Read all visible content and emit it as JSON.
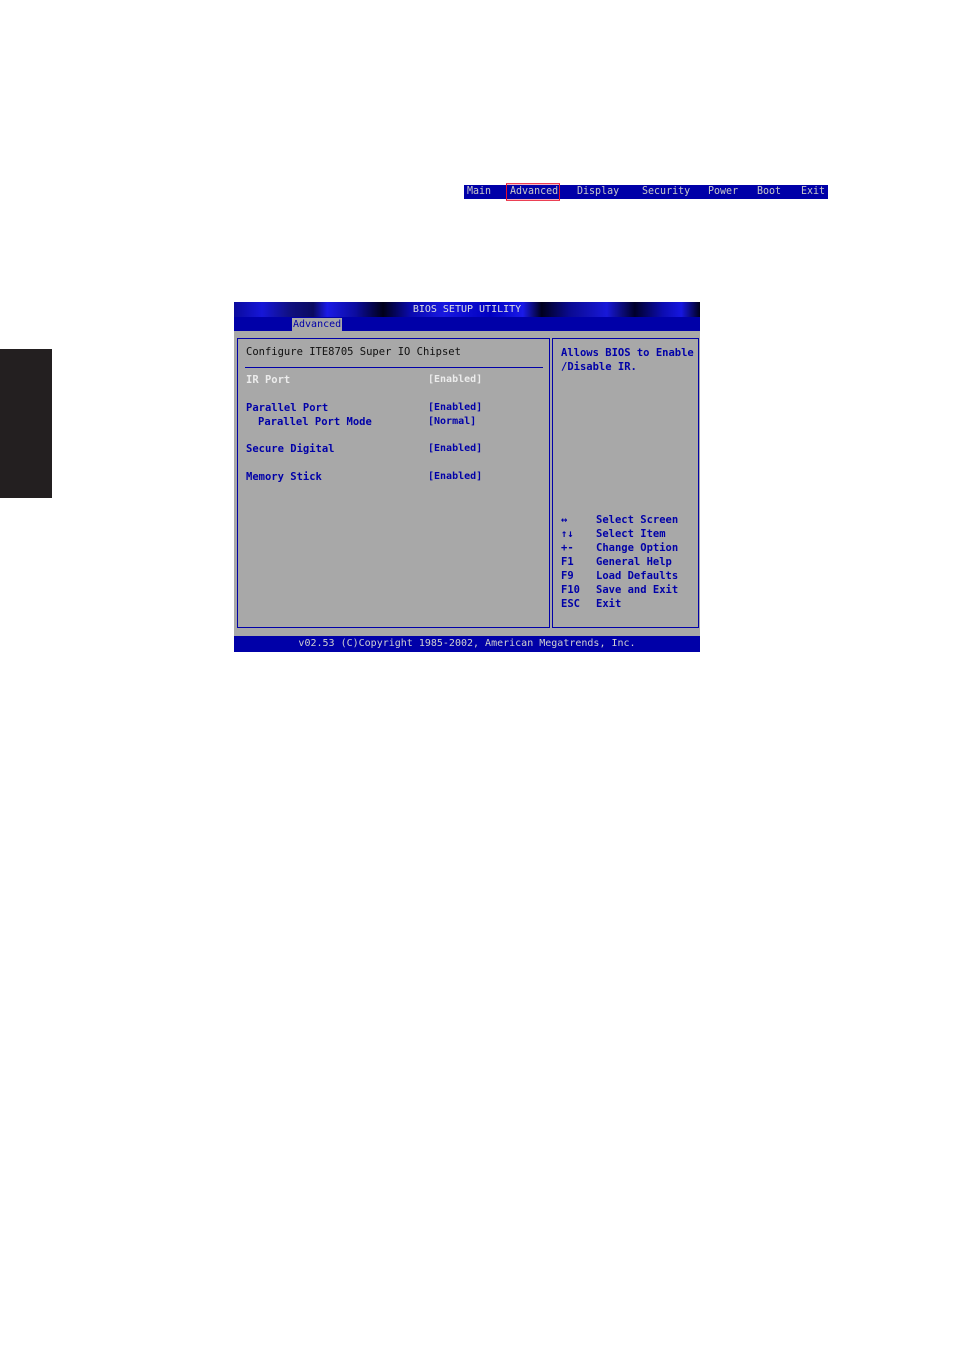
{
  "top_menu": {
    "items": [
      {
        "label": "Main"
      },
      {
        "label": "Advanced",
        "selected": true
      },
      {
        "label": "Display"
      },
      {
        "label": "Security"
      },
      {
        "label": "Power"
      },
      {
        "label": "Boot"
      },
      {
        "label": "Exit"
      }
    ],
    "highlight_color": "#e8102a"
  },
  "bios": {
    "title": "BIOS SETUP UTILITY",
    "active_tab": "Advanced",
    "section_heading": "Configure ITE8705 Super IO Chipset",
    "settings": [
      {
        "label": "IR Port",
        "value": "[Enabled]",
        "selected": true
      },
      {
        "label": "Parallel Port",
        "value": "[Enabled]"
      },
      {
        "label": "Parallel Port Mode",
        "value": "[Normal]",
        "indented": true
      },
      {
        "label": "Secure Digital",
        "value": "[Enabled]"
      },
      {
        "label": "Memory Stick",
        "value": "[Enabled]"
      }
    ],
    "help_text": "Allows BIOS to Enable /Disable IR.",
    "key_legend": [
      {
        "key": "↔",
        "desc": "Select Screen"
      },
      {
        "key": "↑↓",
        "desc": "Select Item"
      },
      {
        "key": "+-",
        "desc": "Change Option"
      },
      {
        "key": "F1",
        "desc": "General Help"
      },
      {
        "key": "F9",
        "desc": "Load Defaults"
      },
      {
        "key": "F10",
        "desc": "Save and Exit"
      },
      {
        "key": "ESC",
        "desc": "Exit"
      }
    ],
    "footer": "v02.53 (C)Copyright 1985-2002, American Megatrends, Inc.",
    "colors": {
      "blue": "#0000a8",
      "gray": "#a8a8a8",
      "selected_text": "#ececec"
    }
  }
}
